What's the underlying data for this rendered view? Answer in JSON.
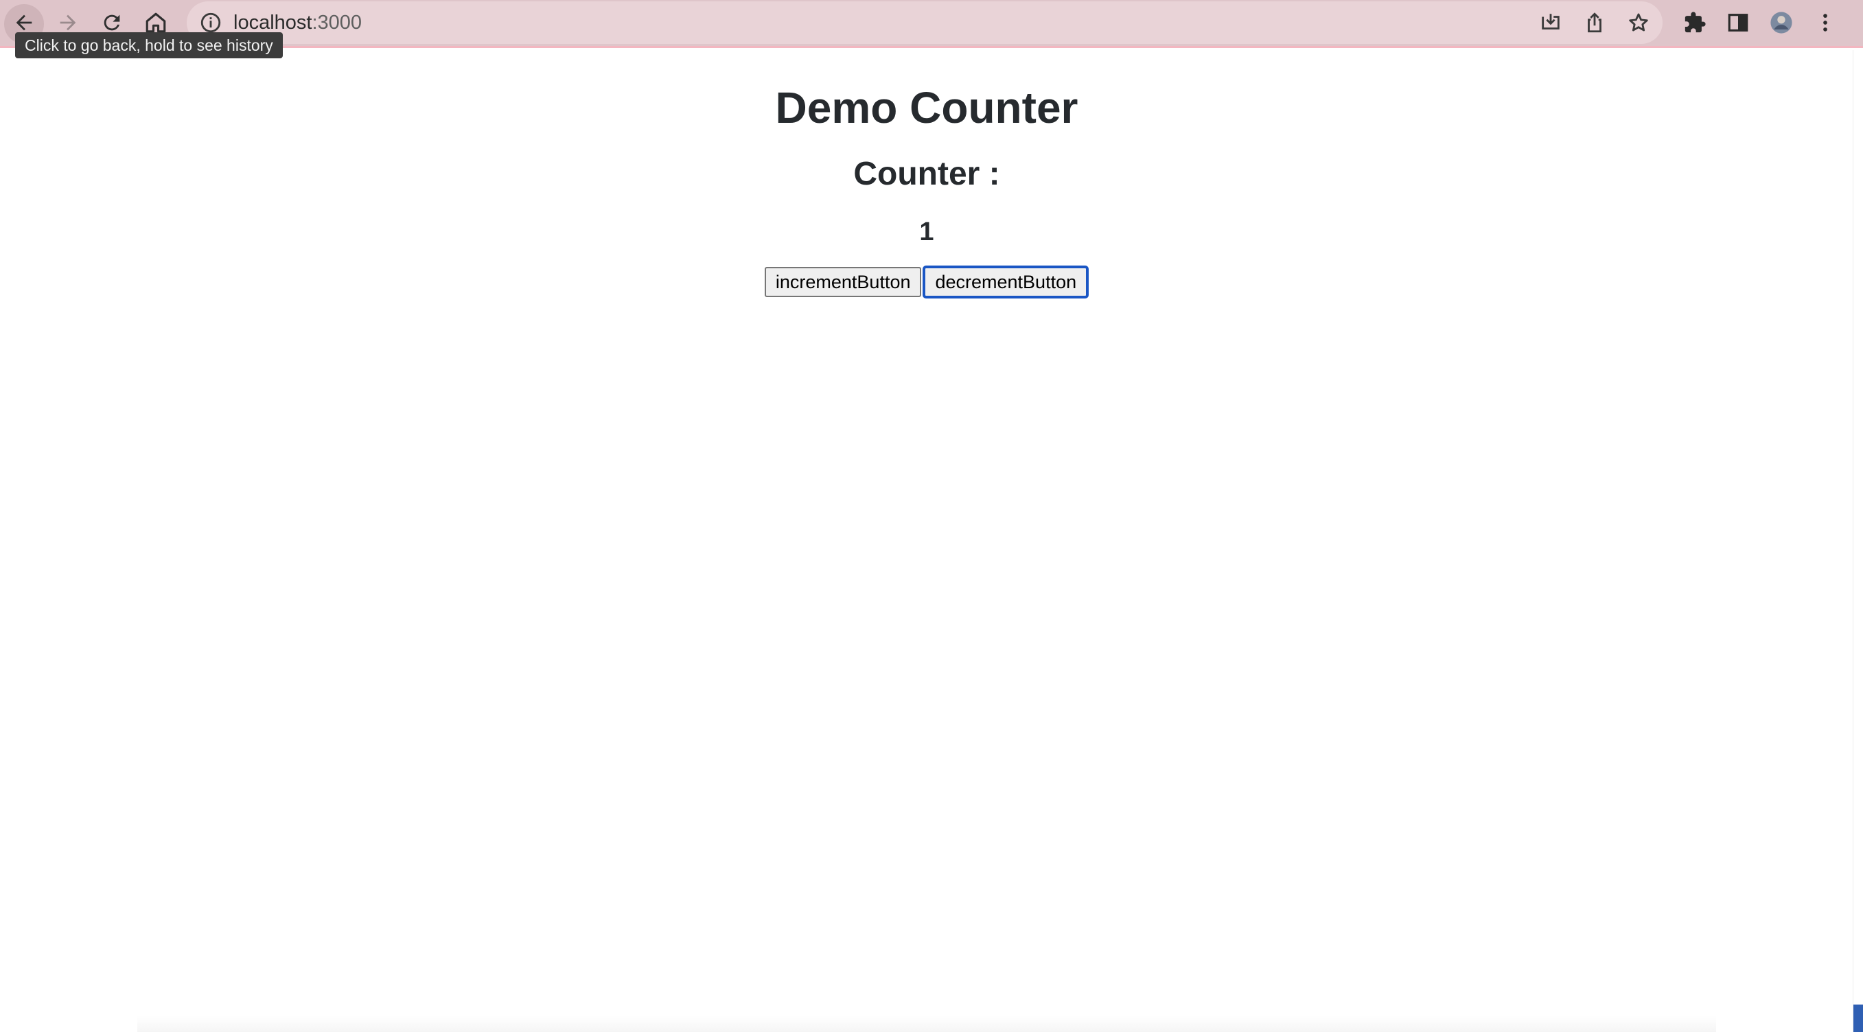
{
  "browser": {
    "url_host": "localhost",
    "url_port": ":3000",
    "tooltip": "Click to go back, hold to see history",
    "toolbar_color": "#dfc5ca",
    "icons": {
      "back": "arrow-left-icon",
      "forward": "arrow-right-icon",
      "reload": "reload-icon",
      "home": "home-icon",
      "site_info": "info-icon",
      "install": "install-icon",
      "share": "share-icon",
      "bookmark": "star-icon",
      "extensions": "puzzle-icon",
      "side_panel": "side-panel-icon",
      "profile": "avatar",
      "menu": "kebab-menu-icon"
    }
  },
  "page": {
    "title": "Demo Counter",
    "counter_label": "Counter :",
    "counter_value": "1",
    "increment_label": "incrementButton",
    "decrement_label": "decrementButton",
    "focused_button": "decrementButton",
    "focus_color": "#1a56c4"
  }
}
